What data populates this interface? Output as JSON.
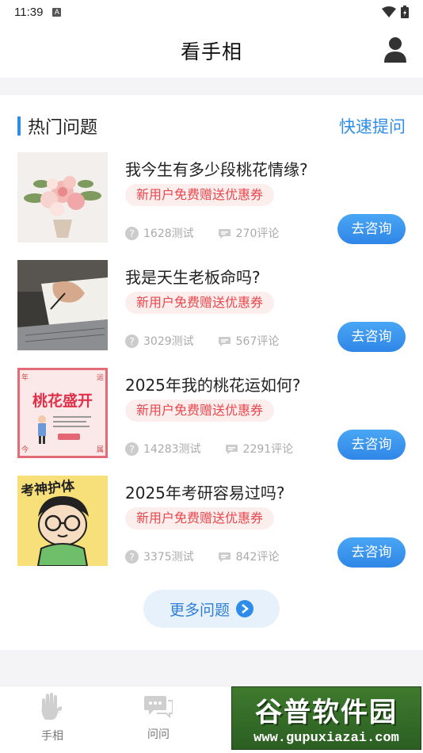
{
  "status_bar": {
    "time": "11:39",
    "badge": "A"
  },
  "nav": {
    "title": "看手相"
  },
  "section": {
    "title": "热门问题",
    "action": "快速提问"
  },
  "questions": [
    {
      "title": "我今生有多少段桃花情缘?",
      "tag": "新用户免费赠送优惠券",
      "tests": "1628测试",
      "comments": "270评论",
      "button": "去咨询"
    },
    {
      "title": "我是天生老板命吗?",
      "tag": "新用户免费赠送优惠券",
      "tests": "3029测试",
      "comments": "567评论",
      "button": "去咨询"
    },
    {
      "title": "2025年我的桃花运如何?",
      "tag": "新用户免费赠送优惠券",
      "tests": "14283测试",
      "comments": "2291评论",
      "button": "去咨询"
    },
    {
      "title": "2025年考研容易过吗?",
      "tag": "新用户免费赠送优惠券",
      "tests": "3375测试",
      "comments": "842评论",
      "button": "去咨询"
    }
  ],
  "thumb3": {
    "text": "桃花盛开",
    "corners": [
      "年",
      "运",
      "今",
      "属"
    ]
  },
  "thumb4": {
    "text": "考神护体"
  },
  "more_button": {
    "label": "更多问题"
  },
  "tabs": [
    {
      "label": "手相",
      "icon": "palm-ai-icon"
    },
    {
      "label": "问问",
      "icon": "chat-icon"
    }
  ],
  "watermark": {
    "title": "谷普软件园",
    "url": "www.gupuxiazai.com"
  },
  "colors": {
    "accent": "#2f8de8",
    "tag_bg": "#fdeeee",
    "tag_text": "#e5484d"
  }
}
